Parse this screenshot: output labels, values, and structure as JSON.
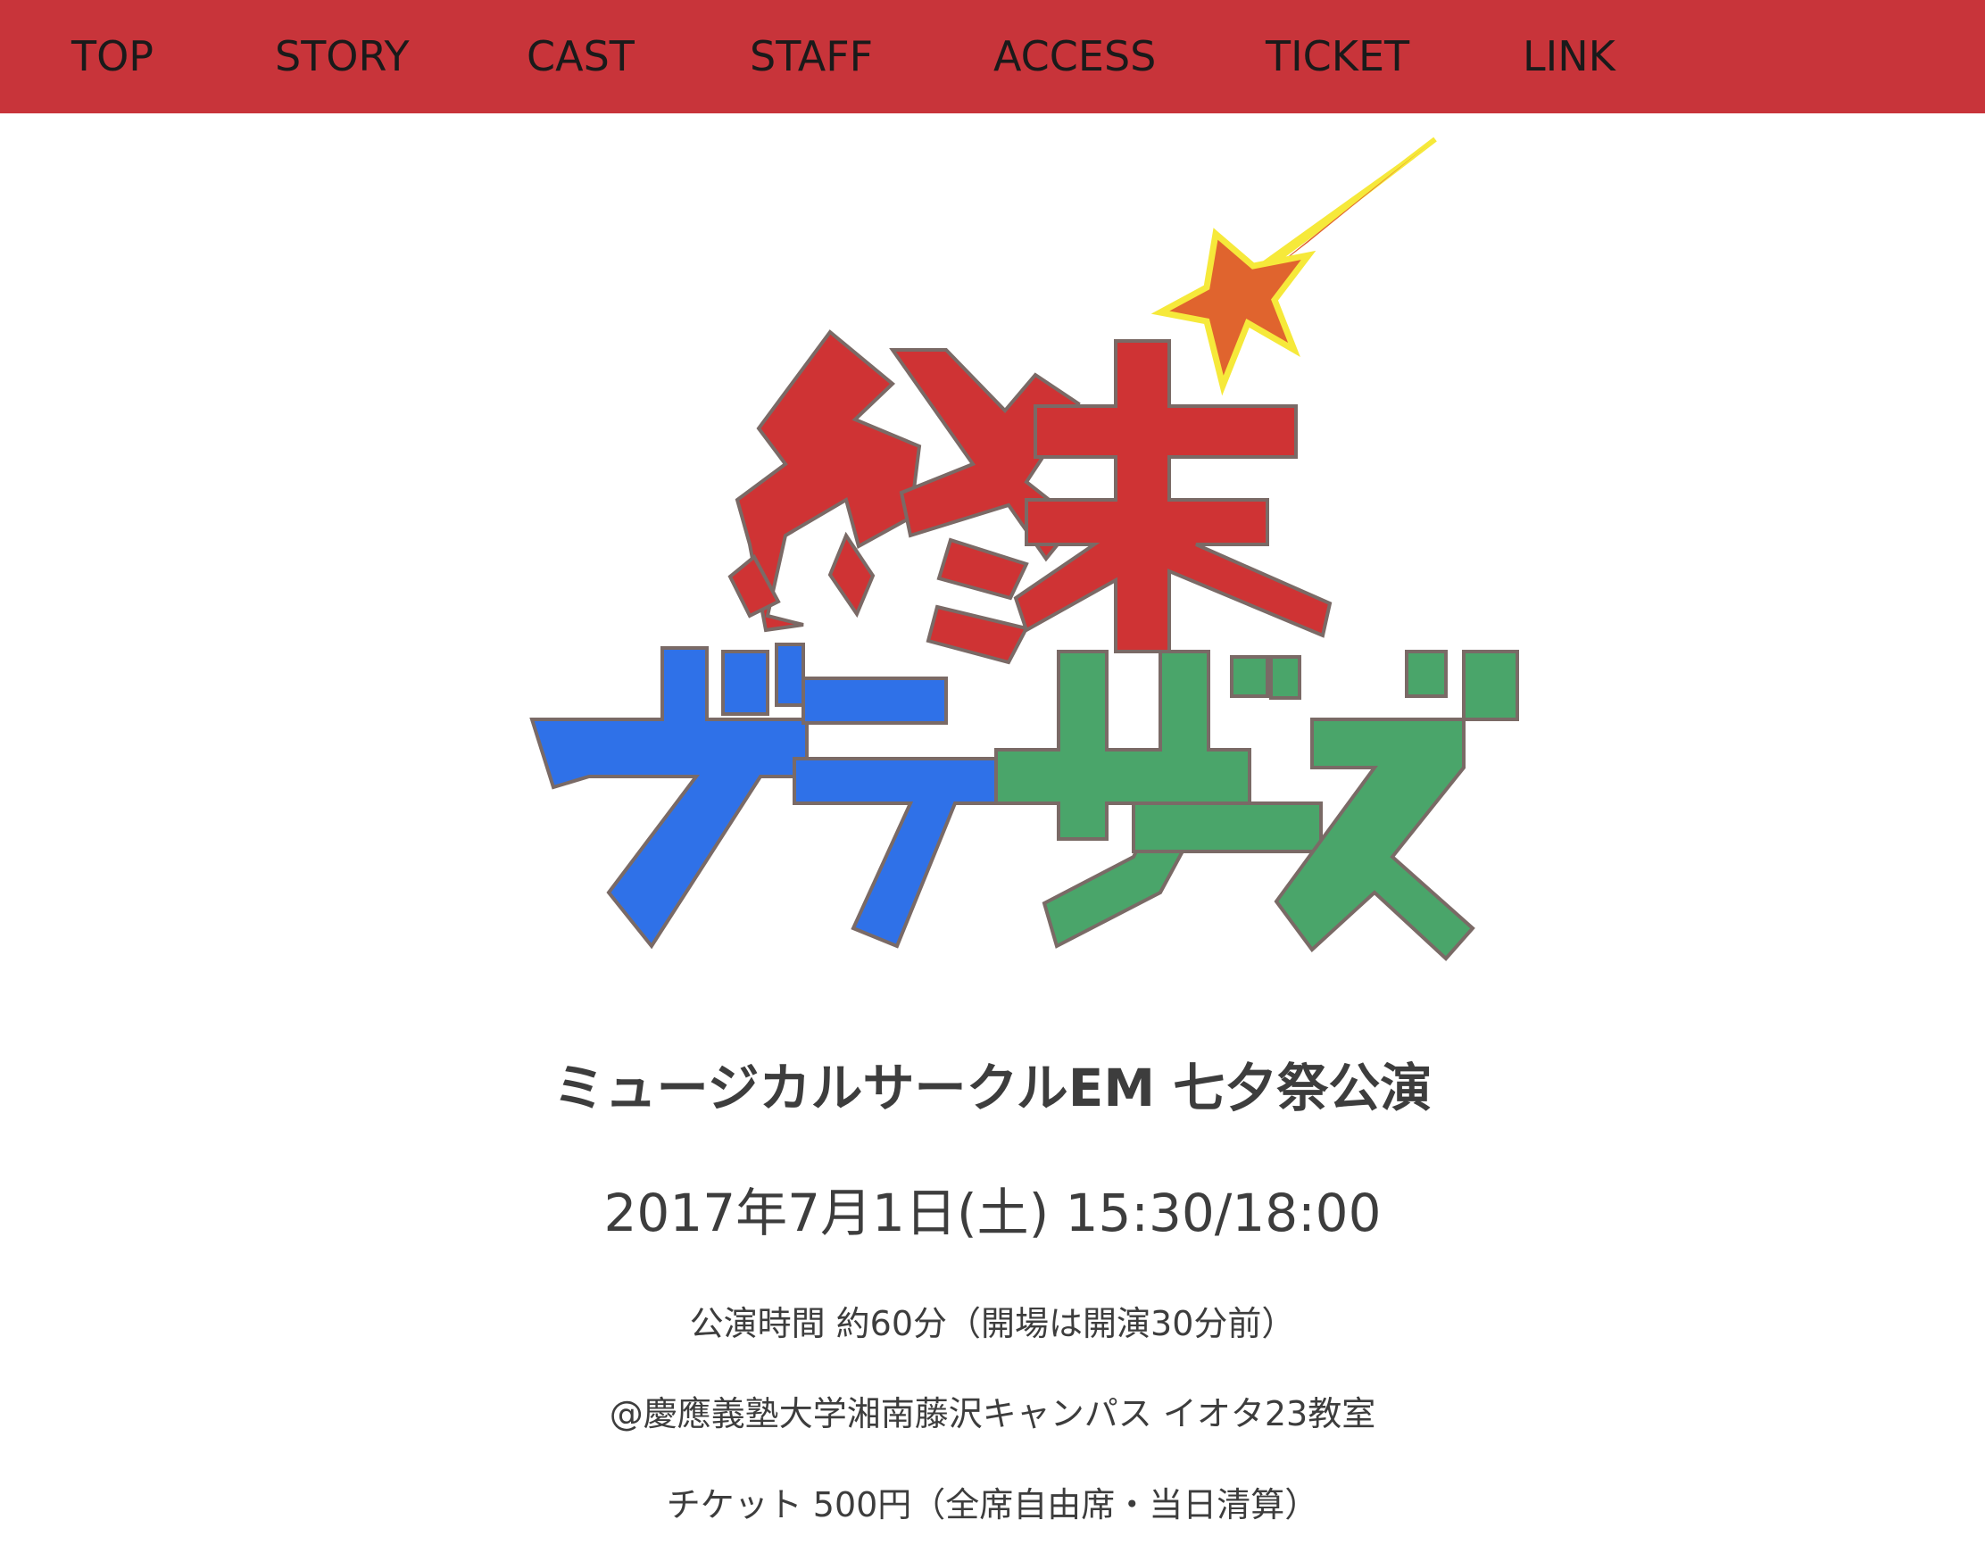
{
  "nav": {
    "items": [
      {
        "label": "TOP"
      },
      {
        "label": "STORY"
      },
      {
        "label": "CAST"
      },
      {
        "label": "STAFF"
      },
      {
        "label": "ACCESS"
      },
      {
        "label": "TICKET"
      },
      {
        "label": "LINK"
      }
    ],
    "background_color": "#c8343a"
  },
  "logo": {
    "title_line1": "終末",
    "title_line2": "ブラザーズ",
    "colors": {
      "red": "#cf3334",
      "blue": "#2f71e8",
      "green": "#4aa56a",
      "star": "#e0642e",
      "star_glow": "#f6e93a"
    },
    "star_icon": "shooting-star-icon"
  },
  "event": {
    "subtitle": "ミュージカルサークルEM 七夕祭公演",
    "datetime": "2017年7月1日(土) 15:30/18:00",
    "duration": "公演時間 約60分（開場は開演30分前）",
    "venue": "@慶應義塾大学湘南藤沢キャンパス イオタ23教室",
    "ticket": "チケット 500円（全席自由席・当日清算）"
  }
}
